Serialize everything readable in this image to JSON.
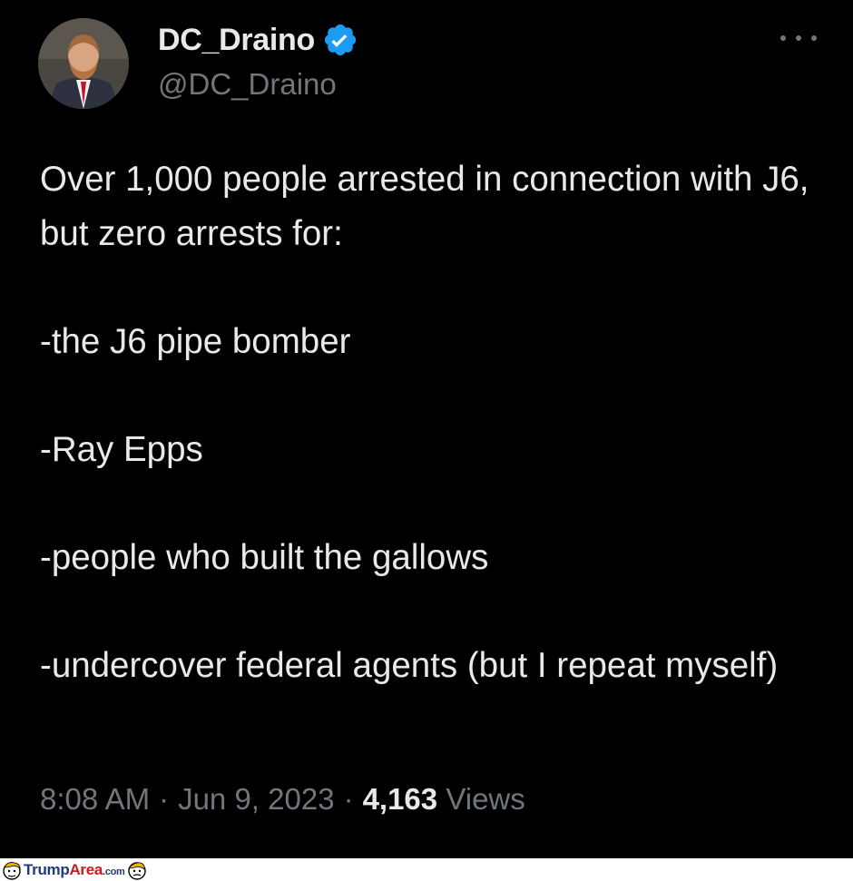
{
  "tweet": {
    "author": {
      "display_name": "DC_Draino",
      "handle": "@DC_Draino",
      "verified": true,
      "verified_icon": "verified-badge-icon",
      "verified_color": "#1d9bf0"
    },
    "more_icon": "more-options-icon",
    "text": "Over 1,000 people arrested in connection with J6, but zero arrests for:\n\n-the J6 pipe bomber\n\n-Ray Epps\n\n-people who built the gallows\n\n-undercover federal agents (but I repeat myself)",
    "time": "8:08 AM",
    "separator": "·",
    "date": "Jun 9, 2023",
    "views_count": "4,163",
    "views_label": "Views"
  },
  "watermark": {
    "part1": "Trump",
    "part2": "Area",
    "part3": ".com"
  },
  "colors": {
    "background": "#000000",
    "primary_text": "#e7e9ea",
    "secondary_text": "#71767b"
  }
}
